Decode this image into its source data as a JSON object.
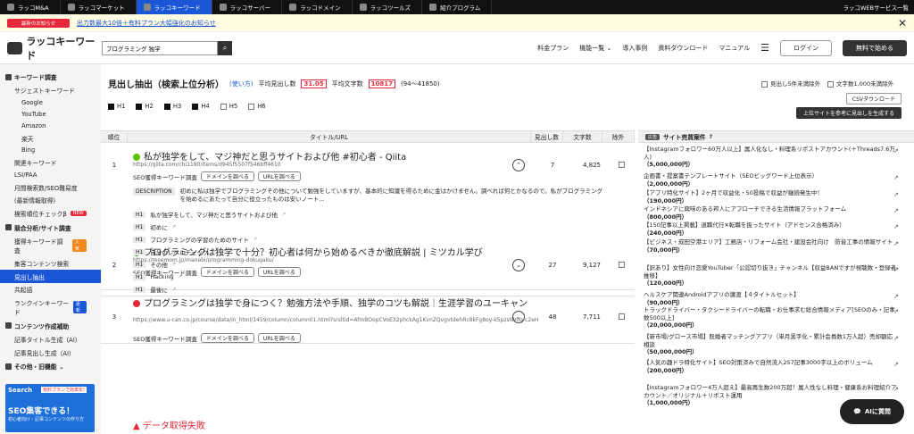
{
  "topnav": {
    "tabs": [
      {
        "label": "ラッコM&A"
      },
      {
        "label": "ラッコマーケット"
      },
      {
        "label": "ラッコキーワード",
        "active": true
      },
      {
        "label": "ラッコサーバー"
      },
      {
        "label": "ラッコドメイン"
      },
      {
        "label": "ラッコツールズ"
      },
      {
        "label": "紹介プログラム"
      }
    ],
    "services": "ラッコWEBサービス一覧"
  },
  "notice": {
    "badge": "最新のお知らせ",
    "text": "出力数最大10倍＋有料プラン大幅強化のお知らせ"
  },
  "header": {
    "logo": "ラッコキーワード",
    "search_value": "プログラミング 独学",
    "nav": [
      "料金プラン",
      "機能一覧 ⌄",
      "導入事例",
      "資料ダウンロード",
      "マニュアル"
    ],
    "login": "ログイン",
    "signup": "無料で始める"
  },
  "sidebar": [
    {
      "type": "sec",
      "label": "キーワード調査"
    },
    {
      "type": "item",
      "label": "サジェストキーワード"
    },
    {
      "type": "sub",
      "label": "Google"
    },
    {
      "type": "sub",
      "label": "YouTube"
    },
    {
      "type": "sub",
      "label": "Amazon"
    },
    {
      "type": "sub",
      "label": "楽天"
    },
    {
      "type": "sub",
      "label": "Bing"
    },
    {
      "type": "item",
      "label": "関連キーワード"
    },
    {
      "type": "item",
      "label": "LSI/PAA"
    },
    {
      "type": "item",
      "label": "月間検索数/SEO難易度"
    },
    {
      "type": "item",
      "label": "(最新情報取得)"
    },
    {
      "type": "item",
      "label": "検索順位チェックβ",
      "tag": "NEW",
      "tagc": "red"
    },
    {
      "type": "sec",
      "label": "競合分析/サイト調査"
    },
    {
      "type": "item",
      "label": "獲得キーワード調査",
      "tag": "人気",
      "tagc": "orange"
    },
    {
      "type": "item",
      "label": "集客コンテンツ検索"
    },
    {
      "type": "item",
      "label": "見出し抽出",
      "active": true
    },
    {
      "type": "item",
      "label": "共起語"
    },
    {
      "type": "item",
      "label": "ランクインキーワード",
      "tag": "更新",
      "tagc": "blue"
    },
    {
      "type": "sec",
      "label": "コンテンツ作成補助"
    },
    {
      "type": "item",
      "label": "記事タイトル生成（AI）"
    },
    {
      "type": "item",
      "label": "記事見出し生成（AI）"
    },
    {
      "type": "sec",
      "label": "その他・旧機能 ⌄"
    }
  ],
  "ad": {
    "top": "Search",
    "tag": "有料プランで効率化!",
    "big": "SEO集客できる！",
    "sub": "初心者向け・記事コンテンツの作り方"
  },
  "main": {
    "title": "見出し抽出（検索上位分析）",
    "help": "(使い方)",
    "avg_heading_label": "平均見出し数",
    "avg_heading": "31.05",
    "avg_chars_label": "平均文字数",
    "avg_chars": "10817",
    "range": "(94〜41850)",
    "filters": [
      {
        "label": "H1",
        "on": true
      },
      {
        "label": "H2",
        "on": true
      },
      {
        "label": "H3",
        "on": true
      },
      {
        "label": "H4",
        "on": true
      },
      {
        "label": "H5",
        "on": false
      },
      {
        "label": "H6",
        "on": false
      }
    ],
    "columns": [
      "順位",
      "タイトル/URL",
      "見出し数",
      "文字数",
      "除外"
    ]
  },
  "results": [
    {
      "rank": "1",
      "title": "私が独学をして、マジ神だと思うサイトおよび他 #初心者 - Qiita",
      "url": "https://qiita.com/chi1180/items/d945f5507f546bff4610",
      "tool": "SEO獲得キーワード調査",
      "b1": "ドメインを調べる",
      "b2": "URLを調べる",
      "count": "7",
      "chars": "4,825",
      "fav": "#55c500"
    },
    {
      "rank": "2",
      "title": "プログラミングは独学で十分？初心者は何から始めるべきか徹底解説 | ミツカル学び",
      "url": "https://resemom.jp/manabi/programming-dokugaku/",
      "tool": "SEO獲得キーワード調査",
      "b1": "ドメインを調べる",
      "b2": "URLを調べる",
      "count": "27",
      "chars": "9,127",
      "fav": "#3a9a3a"
    },
    {
      "rank": "3",
      "title": "プログラミングは独学で身につく？勉強方法や手順、独学のコツも解説｜生涯学習のユーキャン",
      "url": "https://www.u-can.co.jp/course/data/in_html/1459/column/column01.html?srsltid=AfmBOopCVoE32phckAg1KvnZQvgvtdehRc8kFg8oy-k5pzslW0g-c2eH",
      "tool": "SEO獲得キーワード調査",
      "b1": "ドメインを調べる",
      "b2": "URLを調べる",
      "count": "48",
      "chars": "7,711",
      "fav": "#e6283a"
    }
  ],
  "detail": {
    "desc_label": "DESCRIPTION",
    "desc": "初めに私は独学でプログラミングその他について勉強をしていますが、基本的に知識を得るために金はかけません。調べれば何とかなるので。私がプログラミングを始めるにあたって自分に役立ったものは安いノート…",
    "headings": [
      "私が独学をして、マジ神だと思うサイトおよび他",
      "初めに",
      "プログラミングの学習のためのサイト",
      "自分のレベルチェック",
      "その他",
      "Hacking",
      "最後に"
    ],
    "hlabel": "H1"
  },
  "fail": "データ取得失敗",
  "right": {
    "check1": "見出し5件未満除外",
    "check2": "文字数1,000未満除外",
    "csv": "CSVダウンロード",
    "gen": "上位サイトを参考に見出しを生成する",
    "ad_label": "広告",
    "head": "サイト売買案件",
    "items": [
      {
        "t": "【Instagramフォロワー60万人以上】属人化なし・料理系リポストアカウント(＋Threads7.6万人)",
        "p": "（5,000,000円）"
      },
      {
        "t": "企画書・提案書テンプレートサイト（SEOビッグワード上位表示）",
        "p": "（2,000,000円）"
      },
      {
        "t": "【アプリ特化サイト】2ヶ月で収益化・50投稿で収益が継続発生中！",
        "p": "（190,000円）"
      },
      {
        "t": "インドネシアに興味のある邦人にアプローチできる生活情報プラットフォーム",
        "p": "（800,000円）"
      },
      {
        "t": "【150記事以上掲載】退職代行✕転職を扱ったサイト（アドセンス合格済み）",
        "p": "（240,000円）"
      },
      {
        "t": "【ビジネス・成田空港エリア】工務店・リフォーム会社・建設会社向け　防音工事の情報サイト",
        "p": "（70,000円）"
      },
      {
        "t": "【訳あり】女性向け恋愛YouTuber「公認切り抜き」チャンネル【収益BANですが視聴数・登録者推移】",
        "p": "（120,000円）"
      },
      {
        "t": "ヘルスケア関連Androidアプリの譲渡【４タイトルセット】",
        "p": "（90,000円）"
      },
      {
        "t": "トラックドライバー・タクシードライバーの転職・お仕事求む総合情報メディア[SEOのみ・記事数500以上]",
        "p": "（20,000,000円）"
      },
      {
        "t": "【新市場/グロース市場】既婚者マッチングアプリ（単月黒字化・累計会員数1万人超）売却額応相談",
        "p": "（50,000,000円）"
      },
      {
        "t": "【人気の趣ドラ特化サイト】SEO対策済みで自然流入257記事3000字以上のボリューム",
        "p": "（200,000円）"
      },
      {
        "t": "【Instagramフォロワー4万人超え】最高再生数200万超！属人性なし料理・健康系お料理紹介アカウント／オリジナル＋リポスト運用",
        "p": "（1,000,000円）"
      }
    ]
  },
  "ai": "AIに質問"
}
